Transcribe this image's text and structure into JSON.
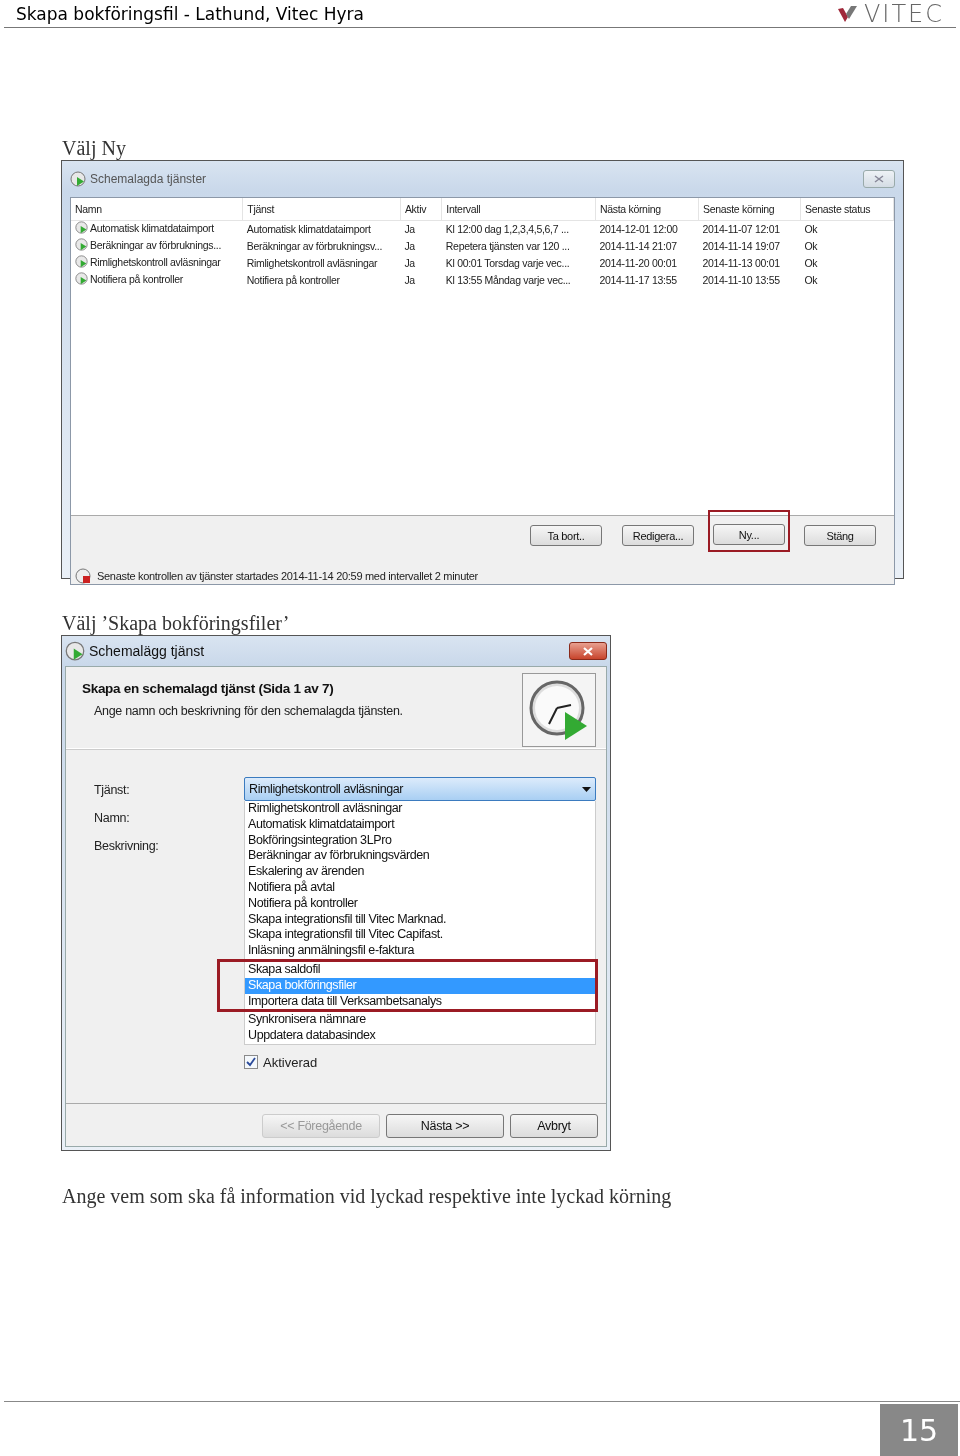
{
  "header": {
    "title": "Skapa bokföringsfil - Lathund, Vitec Hyra",
    "logo": "VITEC"
  },
  "sections": [
    {
      "caption": "Välj Ny",
      "window": {
        "kind": "list",
        "title": "Schemalagda tjänster",
        "columns": [
          "Namn",
          "Tjänst",
          "Aktiv",
          "Intervall",
          "Nästa körning",
          "Senaste körning",
          "Senaste status"
        ],
        "rows": [
          [
            "Automatisk klimatdataimport",
            "Automatisk klimatdataimport",
            "Ja",
            "Kl 12:00 dag 1,2,3,4,5,6,7 ...",
            "2014-12-01 12:00",
            "2014-11-07 12:01",
            "Ok"
          ],
          [
            "Beräkningar av förbruknings...",
            "Beräkningar av förbrukningsv...",
            "Ja",
            "Repetera tjänsten var 120 ...",
            "2014-11-14 21:07",
            "2014-11-14 19:07",
            "Ok"
          ],
          [
            "Rimlighetskontroll avläsningar",
            "Rimlighetskontroll avläsningar",
            "Ja",
            "Kl 00:01 Torsdag varje vec...",
            "2014-11-20 00:01",
            "2014-11-13 00:01",
            "Ok"
          ],
          [
            "Notifiera på kontroller",
            "Notifiera på kontroller",
            "Ja",
            "Kl 13:55 Måndag varje vec...",
            "2014-11-17 13:55",
            "2014-11-10 13:55",
            "Ok"
          ]
        ],
        "buttons": [
          {
            "label": "Ta bort..",
            "framed": false
          },
          {
            "label": "Redigera...",
            "framed": false
          },
          {
            "label": "Ny...",
            "framed": true
          },
          {
            "label": "Stäng",
            "framed": false
          }
        ],
        "status": "Senaste kontrollen av tjänster startades 2014-11-14 20:59 med intervallet 2 minuter"
      }
    },
    {
      "caption": "Välj ’Skapa bokföringsfiler’",
      "window": {
        "kind": "wizard",
        "title": "Schemalägg tjänst",
        "heading": "Skapa en schemalagd tjänst (Sida 1 av 7)",
        "subheading": "Ange namn och beskrivning för den schemalagda tjänsten.",
        "labels": [
          "Tjänst:",
          "Namn:",
          "Beskrivning:"
        ],
        "dropdown": "Rimlighetskontroll avläsningar",
        "options": [
          {
            "label": "Rimlighetskontroll avläsningar",
            "selected": false,
            "framed": false
          },
          {
            "label": "Automatisk klimatdataimport",
            "selected": false,
            "framed": false
          },
          {
            "label": "Bokföringsintegration 3LPro",
            "selected": false,
            "framed": false
          },
          {
            "label": "Beräkningar av förbrukningsvärden",
            "selected": false,
            "framed": false
          },
          {
            "label": "Eskalering av ärenden",
            "selected": false,
            "framed": false
          },
          {
            "label": "Notifiera på avtal",
            "selected": false,
            "framed": false
          },
          {
            "label": "Notifiera på kontroller",
            "selected": false,
            "framed": false
          },
          {
            "label": "Skapa integrationsfil till Vitec Marknad.",
            "selected": false,
            "framed": false
          },
          {
            "label": "Skapa integrationsfil till Vitec Capifast.",
            "selected": false,
            "framed": false
          },
          {
            "label": "Inläsning anmälningsfil e-faktura",
            "selected": false,
            "framed": false
          },
          {
            "label": "Skapa saldofil",
            "selected": false,
            "framed": true
          },
          {
            "label": "Skapa bokföringsfiler",
            "selected": true,
            "framed": true
          },
          {
            "label": "Importera data till Verksambetsanalys",
            "selected": false,
            "framed": true
          },
          {
            "label": "Synkronisera nämnare",
            "selected": false,
            "framed": false
          },
          {
            "label": "Uppdatera databasindex",
            "selected": false,
            "framed": false
          }
        ],
        "checkbox": {
          "label": "Aktiverad",
          "checked": true
        },
        "buttons": [
          {
            "label": "<< Föregående",
            "disabled": true
          },
          {
            "label": "Nästa >>",
            "disabled": false
          },
          {
            "label": "Avbryt",
            "disabled": false
          }
        ]
      }
    }
  ],
  "footer_text": "Ange vem som ska få information vid lyckad respektive inte lyckad körning",
  "page_number": "15"
}
